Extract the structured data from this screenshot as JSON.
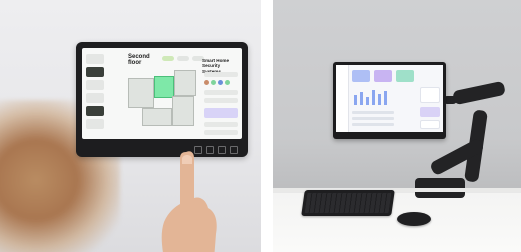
{
  "left_photo": {
    "description_icon": "wall-mounted-tablet",
    "tablet": {
      "floor_title": "Second\nfloor",
      "system_title": "Smart Home Security Systems"
    }
  },
  "right_photo": {
    "description_icon": "monitor-on-desk-arm"
  },
  "colors": {
    "tablet_accent": "#7ee8a8",
    "monitor_card_blue": "#aebff5",
    "monitor_card_purple": "#c8b4f2",
    "monitor_card_green": "#9fe0c9"
  }
}
